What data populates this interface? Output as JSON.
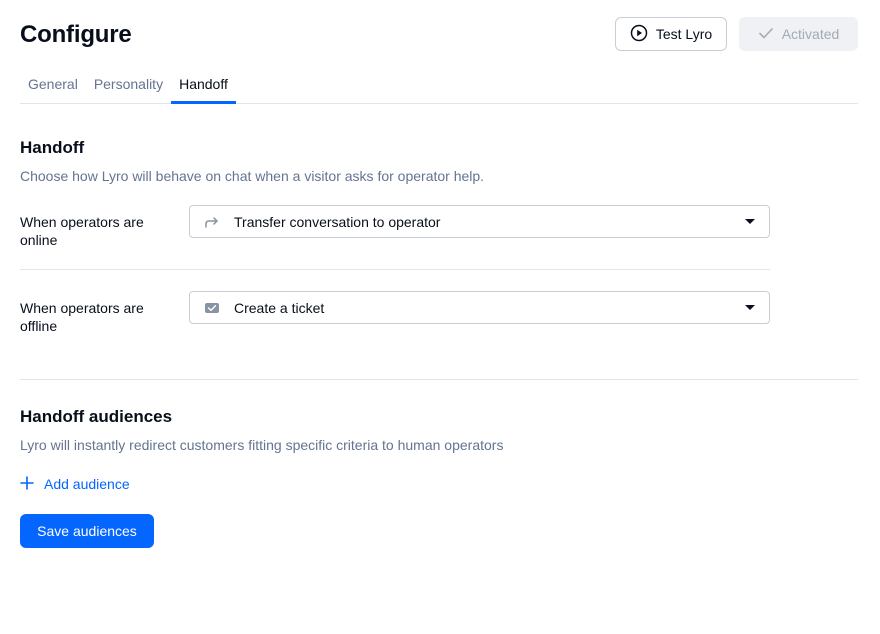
{
  "header": {
    "title": "Configure",
    "test_label": "Test Lyro",
    "activated_label": "Activated"
  },
  "tabs": [
    {
      "label": "General",
      "active": false
    },
    {
      "label": "Personality",
      "active": false
    },
    {
      "label": "Handoff",
      "active": true
    }
  ],
  "handoff": {
    "title": "Handoff",
    "description": "Choose how Lyro will behave on chat when a visitor asks for operator help.",
    "online": {
      "label": "When operators are online",
      "value": "Transfer conversation to operator",
      "icon": "arrow-forward-icon"
    },
    "offline": {
      "label": "When operators are offline",
      "value": "Create a ticket",
      "icon": "ticket-icon"
    }
  },
  "audiences": {
    "title": "Handoff audiences",
    "description": "Lyro will instantly redirect customers fitting specific criteria to human operators",
    "add_label": "Add audience",
    "save_label": "Save audiences"
  },
  "colors": {
    "accent": "#0566ff",
    "text": "#080f1a",
    "muted": "#647491",
    "border": "#c9ced6"
  }
}
